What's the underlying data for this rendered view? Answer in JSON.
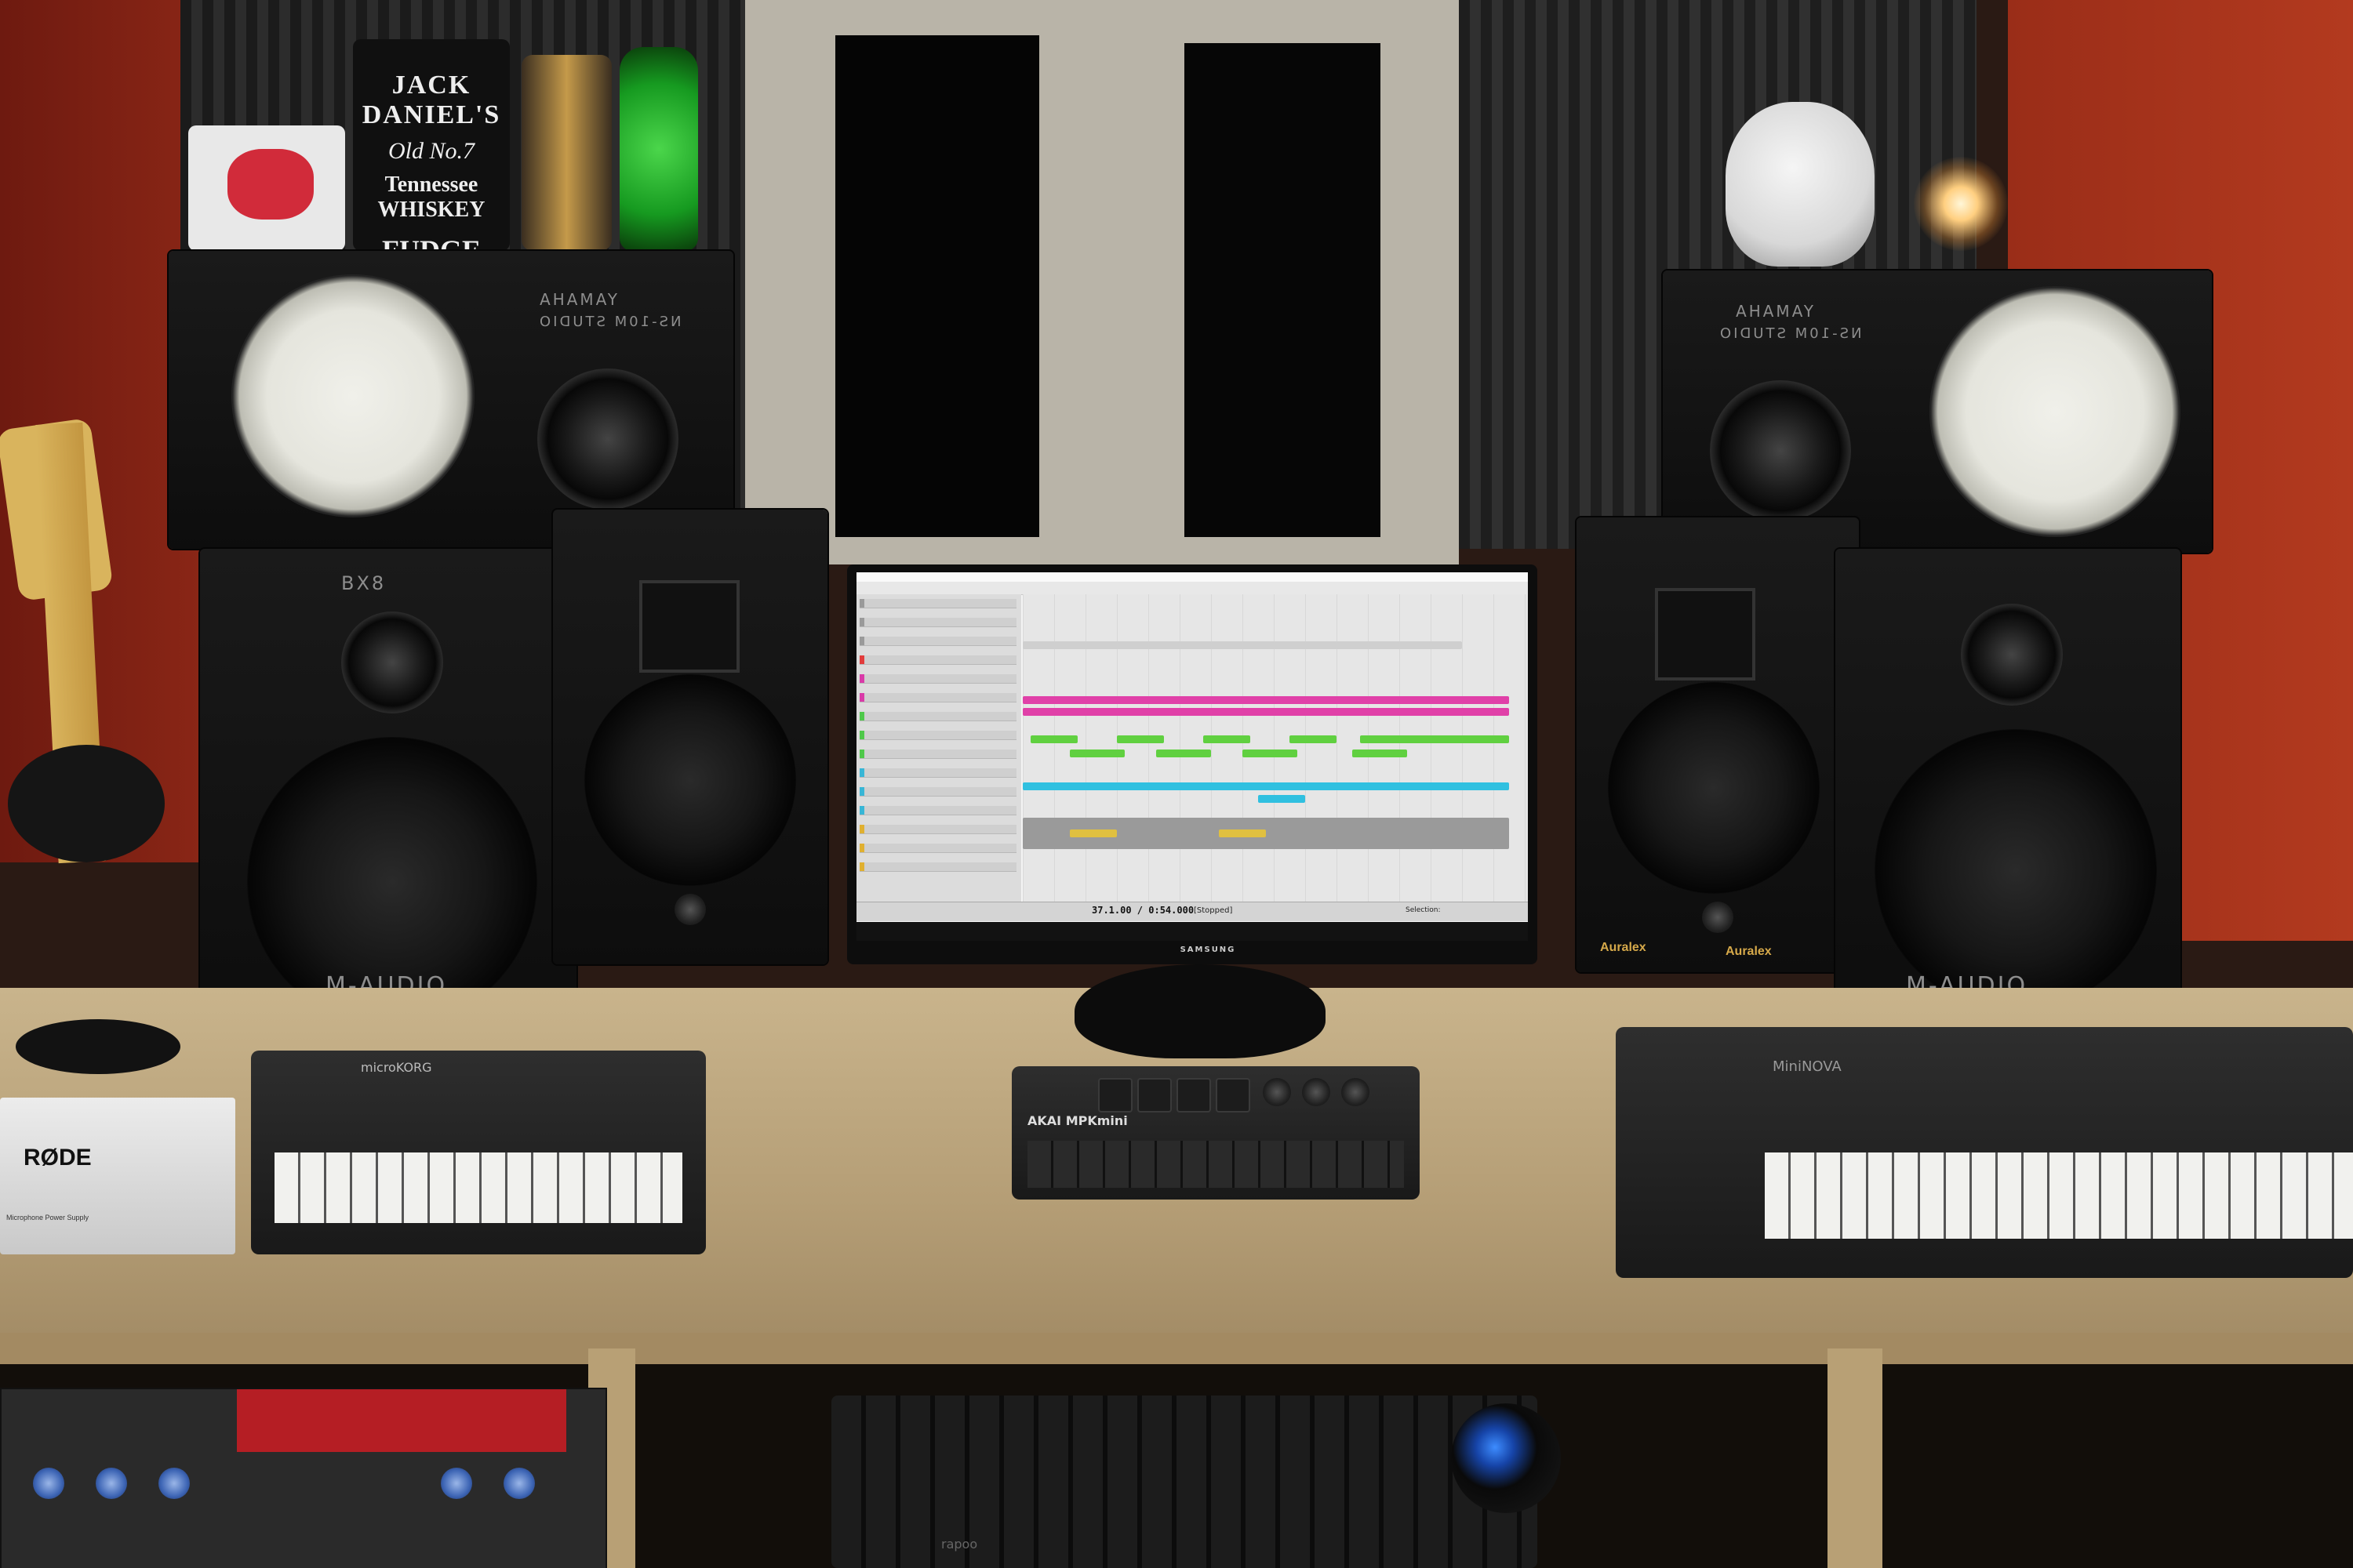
{
  "scene": {
    "tin_labels": [
      "JACK DANIEL'S",
      "Old No.7",
      "Tennessee WHISKEY",
      "FUDGE"
    ],
    "left_top_speaker": {
      "brand": "YAMAHA",
      "model": "NS-10M STUDIO"
    },
    "right_top_speaker": {
      "brand": "YAMAHA",
      "model": "NS-10M STUDIO"
    },
    "left_bottom_speaker": {
      "brand": "M-AUDIO",
      "model": "BX8"
    },
    "right_bottom_speaker": {
      "brand": "M-AUDIO"
    },
    "auralex_labels": [
      "Auralex",
      "Auralex"
    ],
    "monitor_brand": "SAMSUNG",
    "rode_label": "RØDE",
    "rode_sub": "Microphone Power Supply",
    "mpk_label": "AKAI MPKmini",
    "minilogue_label": "microKORG",
    "novation_label": "MiniNOVA",
    "keyboard_brand": "rapoo"
  },
  "daw": {
    "transport_time": "37.1.00 / 0:54.000",
    "transport_state": "[Stopped]",
    "selection_label": "Selection:",
    "track_colors": [
      "#9a9a9a",
      "#9a9a9a",
      "#9a9a9a",
      "#e23c3c",
      "#d93aa8",
      "#d93aa8",
      "#4fc84a",
      "#4fc84a",
      "#4fc84a",
      "#38b6d6",
      "#38b6d6",
      "#38b6d6",
      "#e0b030",
      "#e0b030",
      "#e0b030"
    ]
  },
  "colors": {
    "wall": "#8a2616",
    "desk": "#c0a87f",
    "clip_magenta": "#e040a8",
    "clip_green": "#60d040",
    "clip_cyan": "#30c0e0",
    "clip_yellow": "#e0c040"
  }
}
